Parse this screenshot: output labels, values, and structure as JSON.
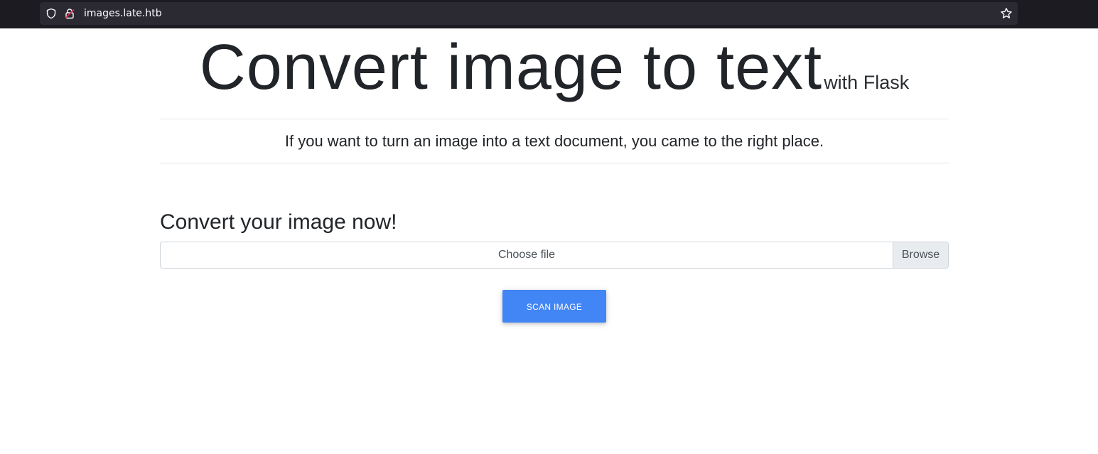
{
  "browser": {
    "url": "images.late.htb",
    "icons": {
      "shield": "shield-icon",
      "lock": "insecure-lock-icon",
      "star": "bookmark-star-icon"
    }
  },
  "header": {
    "title": "Convert image to text",
    "subtitle": "with Flask",
    "lead": "If you want to turn an image into a text document, you came to the right place."
  },
  "form": {
    "heading": "Convert your image now!",
    "file_label": "Choose file",
    "browse_label": "Browse",
    "submit_label": "SCAN IMAGE"
  },
  "colors": {
    "primary_button": "#4285f4",
    "browser_bar": "#1c1b22",
    "urlbar": "#2b2a33"
  }
}
